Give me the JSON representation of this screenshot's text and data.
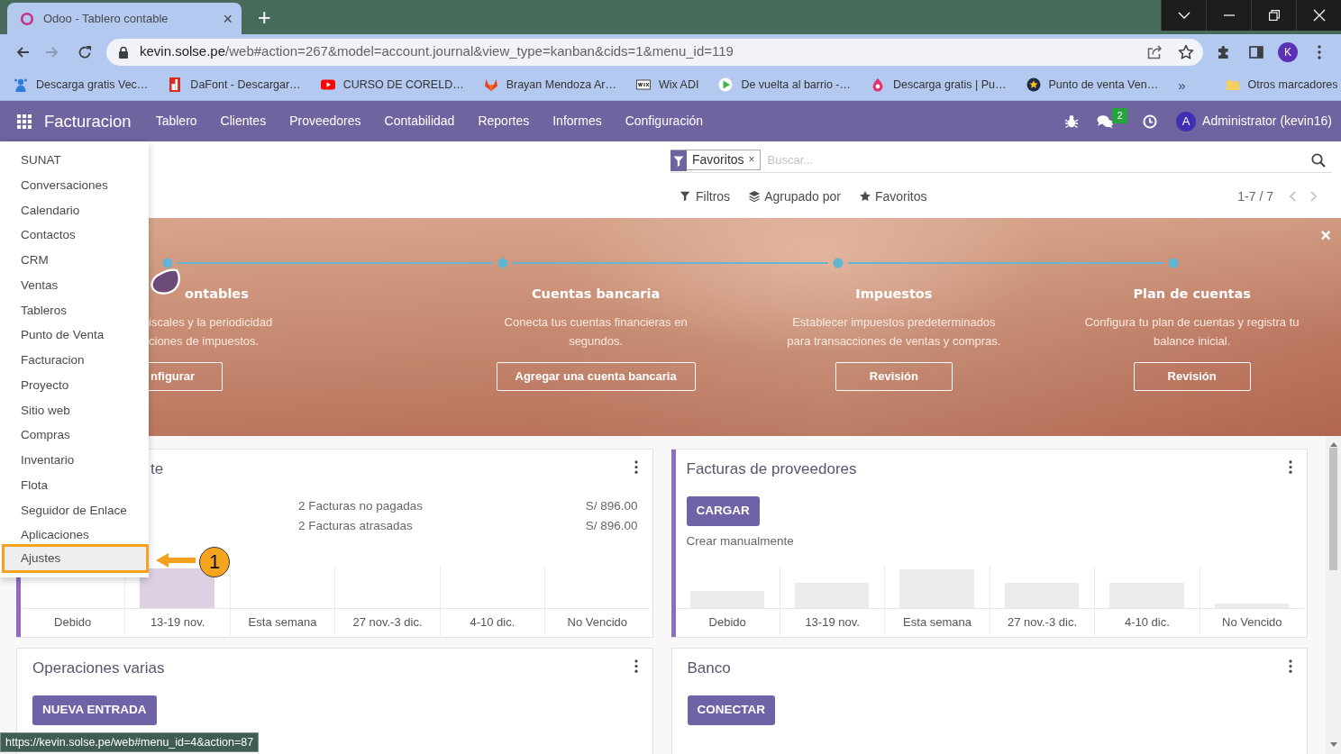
{
  "browser": {
    "tab": {
      "title": "Odoo - Tablero contable",
      "close": "×"
    },
    "new_tab": "+",
    "back": {
      "disabled": false
    },
    "forward": {
      "disabled": true
    },
    "address": {
      "host": "kevin.solse.pe",
      "path": "/web#action=267&model=account.journal&view_type=kanban&cids=1&menu_id=119"
    },
    "profile": "K",
    "bookmarks": [
      {
        "kind": "figure",
        "label": "Descarga gratis Vec…"
      },
      {
        "kind": "tile",
        "label": "DaFont - Descargar…"
      },
      {
        "kind": "video",
        "label": "CURSO DE CORELD…"
      },
      {
        "kind": "fox",
        "label": "Brayan Mendoza Ar…"
      },
      {
        "kind": "wordmark",
        "label": "Wix ADI"
      },
      {
        "kind": "play",
        "label": "De vuelta al barrio -…"
      },
      {
        "kind": "drop",
        "label": "Descarga gratis | Pu…"
      },
      {
        "kind": "badge",
        "label": "Punto de venta Ven…"
      }
    ],
    "more": "»",
    "other_bookmarks": "Otros marcadores",
    "status_url": "https://kevin.solse.pe/web#menu_id=4&action=87"
  },
  "navbar": {
    "app": "Facturacion",
    "menu": [
      "Tablero",
      "Clientes",
      "Proveedores",
      "Contabilidad",
      "Reportes",
      "Informes",
      "Configuración"
    ],
    "messages_badge": "2",
    "avatar": "A",
    "user": "Administrator (kevin16)"
  },
  "apps_menu": {
    "items": [
      {
        "label": "SUNAT",
        "highlighted": false
      },
      {
        "label": "Conversaciones",
        "highlighted": false
      },
      {
        "label": "Calendario",
        "highlighted": false
      },
      {
        "label": "Contactos",
        "highlighted": false
      },
      {
        "label": "CRM",
        "highlighted": false
      },
      {
        "label": "Ventas",
        "highlighted": false
      },
      {
        "label": "Tableros",
        "highlighted": false
      },
      {
        "label": "Punto de Venta",
        "highlighted": false
      },
      {
        "label": "Facturacion",
        "highlighted": false
      },
      {
        "label": "Proyecto",
        "highlighted": false
      },
      {
        "label": "Sitio web",
        "highlighted": false
      },
      {
        "label": "Compras",
        "highlighted": false
      },
      {
        "label": "Inventario",
        "highlighted": false
      },
      {
        "label": "Flota",
        "highlighted": false
      },
      {
        "label": "Seguidor de Enlace",
        "highlighted": false
      },
      {
        "label": "Aplicaciones",
        "highlighted": false
      },
      {
        "label": "Ajustes",
        "highlighted": true
      }
    ]
  },
  "annotation": {
    "number": "1"
  },
  "search": {
    "facet": "Favoritos",
    "facet_remove": "×",
    "placeholder": "Buscar...",
    "options": [
      {
        "kind": "filter",
        "label": "Filtros"
      },
      {
        "kind": "group",
        "label": "Agrupado por"
      },
      {
        "kind": "favorite",
        "label": "Favoritos"
      }
    ],
    "pager": "1-7 / 7"
  },
  "onboarding": {
    "close": "×",
    "steps": [
      {
        "title": "ontables",
        "description": [
          "iscales y la periodicidad",
          "ciones de impuestos."
        ],
        "button": "nfigurar",
        "clipped": true,
        "current": true
      },
      {
        "title": "Cuentas bancaria",
        "description": [
          "Conecta tus cuentas financieras en",
          "segundos."
        ],
        "button": "Agregar una cuenta bancaria",
        "clipped": false,
        "current": false
      },
      {
        "title": "Impuestos",
        "description": [
          "Establecer impuestos predeterminados",
          "para transacciones de ventas y compras."
        ],
        "button": "Revisión",
        "clipped": false,
        "current": false
      },
      {
        "title": "Plan de cuentas",
        "description": [
          "Configura tu plan de cuentas y registra tu",
          "balance inicial."
        ],
        "button": "Revisión",
        "clipped": false,
        "current": false
      }
    ]
  },
  "journals": [
    {
      "title": "te",
      "clipped": true,
      "color": "#8f6bc2",
      "stats": [
        {
          "label": "2 Facturas no pagadas",
          "amount": "S/ 896.00"
        },
        {
          "label": "2 Facturas atrasadas",
          "amount": "S/ 896.00"
        }
      ],
      "chart": {
        "sample": false,
        "labels": [
          "Debido",
          "13-19 nov.",
          "Esta semana",
          "27 nov.-3 dic.",
          "4-10 dic.",
          "No Vencido"
        ]
      }
    },
    {
      "title": "Facturas de proveedores",
      "clipped": false,
      "color": "#8f6bc2",
      "button": "CARGAR",
      "link": "Crear manualmente",
      "chart": {
        "sample": true,
        "labels": [
          "Debido",
          "13-19 nov.",
          "Esta semana",
          "27 nov.-3 dic.",
          "4-10 dic.",
          "No Vencido"
        ]
      }
    },
    {
      "title": "Operaciones varias",
      "clipped": false,
      "button": "NUEVA ENTRADA"
    },
    {
      "title": "Banco",
      "clipped": false,
      "button": "CONECTAR"
    }
  ]
}
